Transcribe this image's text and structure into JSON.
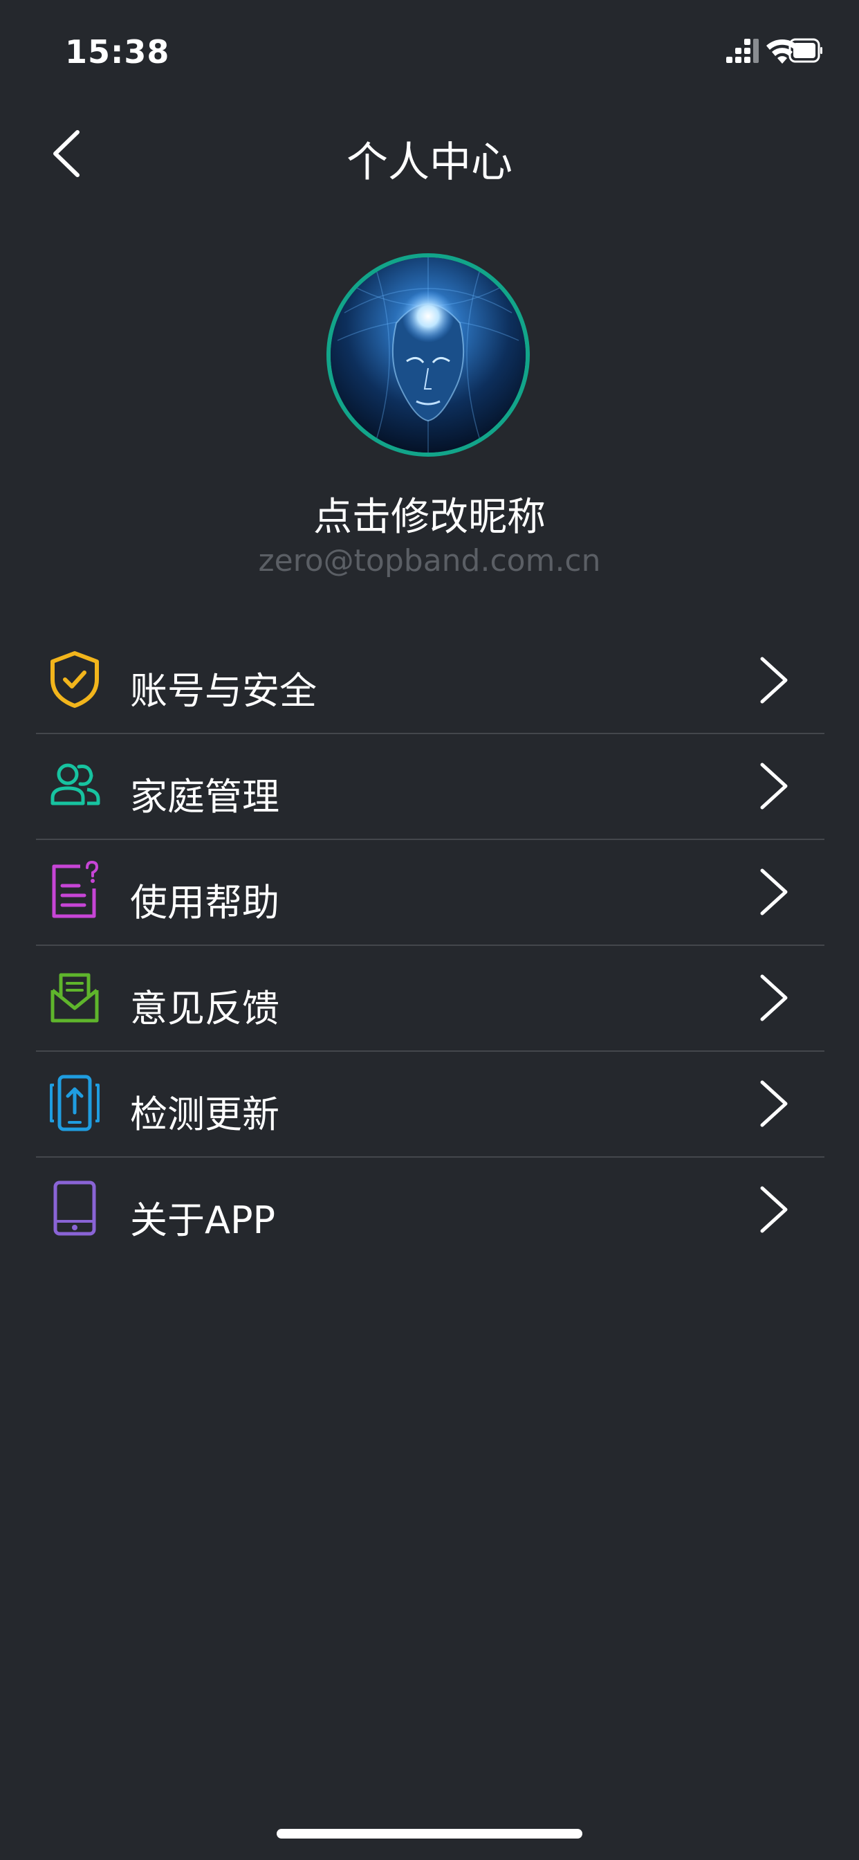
{
  "status_bar": {
    "time": "15:38",
    "icons": [
      "cellular-signal-icon",
      "wifi-icon",
      "battery-icon"
    ]
  },
  "nav": {
    "title": "个人中心",
    "back_icon": "chevron-left-icon"
  },
  "profile": {
    "nickname": "点击修改昵称",
    "email": "zero@topband.com.cn",
    "avatar_ring_color": "#12a58a"
  },
  "menu": {
    "items": [
      {
        "label": "账号与安全",
        "icon": "shield-check-icon",
        "color": "#f2b51c"
      },
      {
        "label": "家庭管理",
        "icon": "family-icon",
        "color": "#17c3a0"
      },
      {
        "label": "使用帮助",
        "icon": "help-document-icon",
        "color": "#c745d6"
      },
      {
        "label": "意见反馈",
        "icon": "feedback-envelope-icon",
        "color": "#5fb52c"
      },
      {
        "label": "检测更新",
        "icon": "update-phone-icon",
        "color": "#1f9de0"
      },
      {
        "label": "关于APP",
        "icon": "tablet-icon",
        "color": "#8a64d6"
      }
    ],
    "chevron_icon": "chevron-right-icon"
  },
  "colors": {
    "background": "#25282d",
    "divider": "#44474c",
    "email_text": "#5b5f65"
  }
}
